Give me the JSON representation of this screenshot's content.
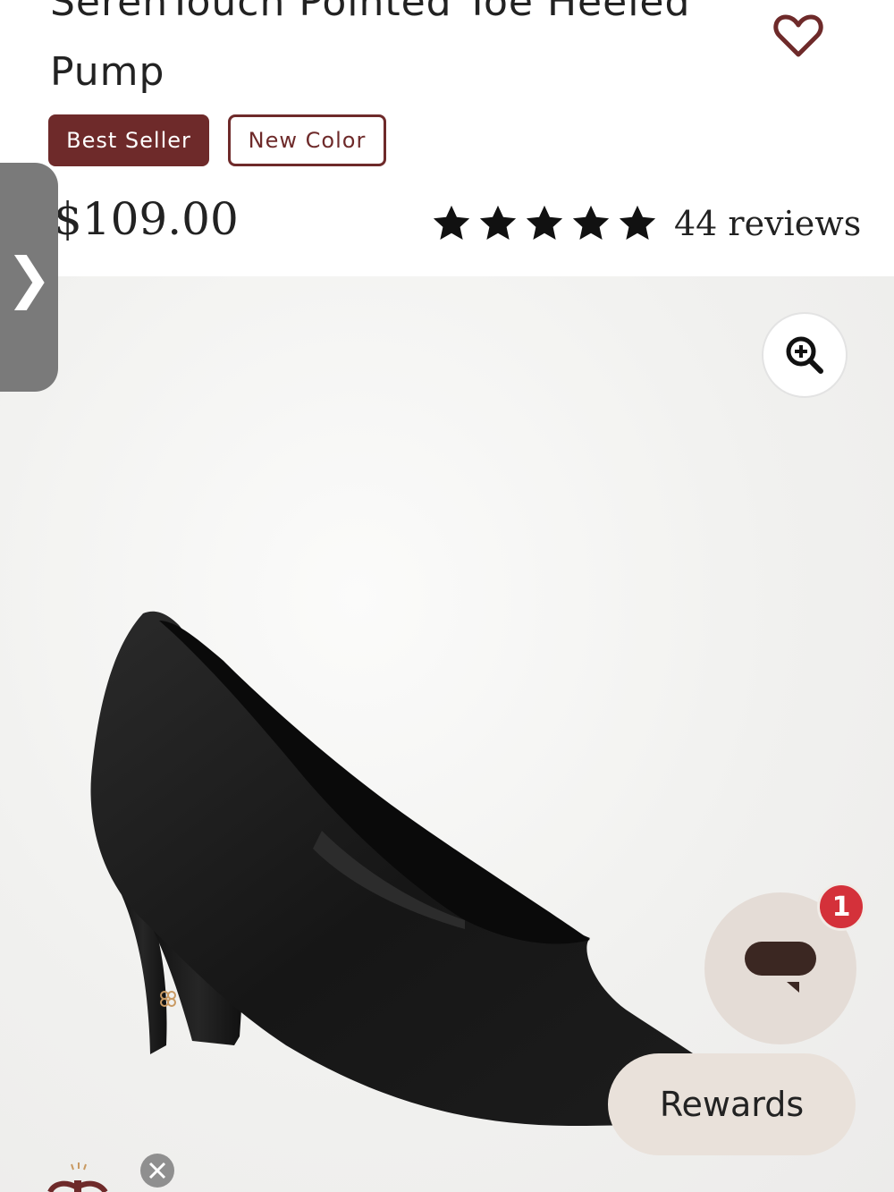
{
  "product": {
    "title": "SerenTouch Pointed Toe Heeled Pump",
    "badges": {
      "best_seller": "Best Seller",
      "new_color": "New Color"
    },
    "price": "$109.00",
    "rating": {
      "stars": 5,
      "max": 5,
      "reviews_label": "44 reviews"
    }
  },
  "icons": {
    "wishlist": "heart-outline-icon",
    "zoom": "zoom-in-icon",
    "side_tab": "chevron-right-icon",
    "chat": "chat-bubble-icon",
    "close": "close-icon",
    "gift": "gift-icon"
  },
  "chat": {
    "notification_count": "1"
  },
  "rewards": {
    "label": "Rewards"
  },
  "side_tab": {
    "glyph": "❯"
  },
  "colors": {
    "brand": "#6e2a2a",
    "badge_text": "#ffffff",
    "notification": "#d4313a",
    "rewards_bg": "#e9e1da",
    "chat_bg": "#e4dcd6"
  }
}
